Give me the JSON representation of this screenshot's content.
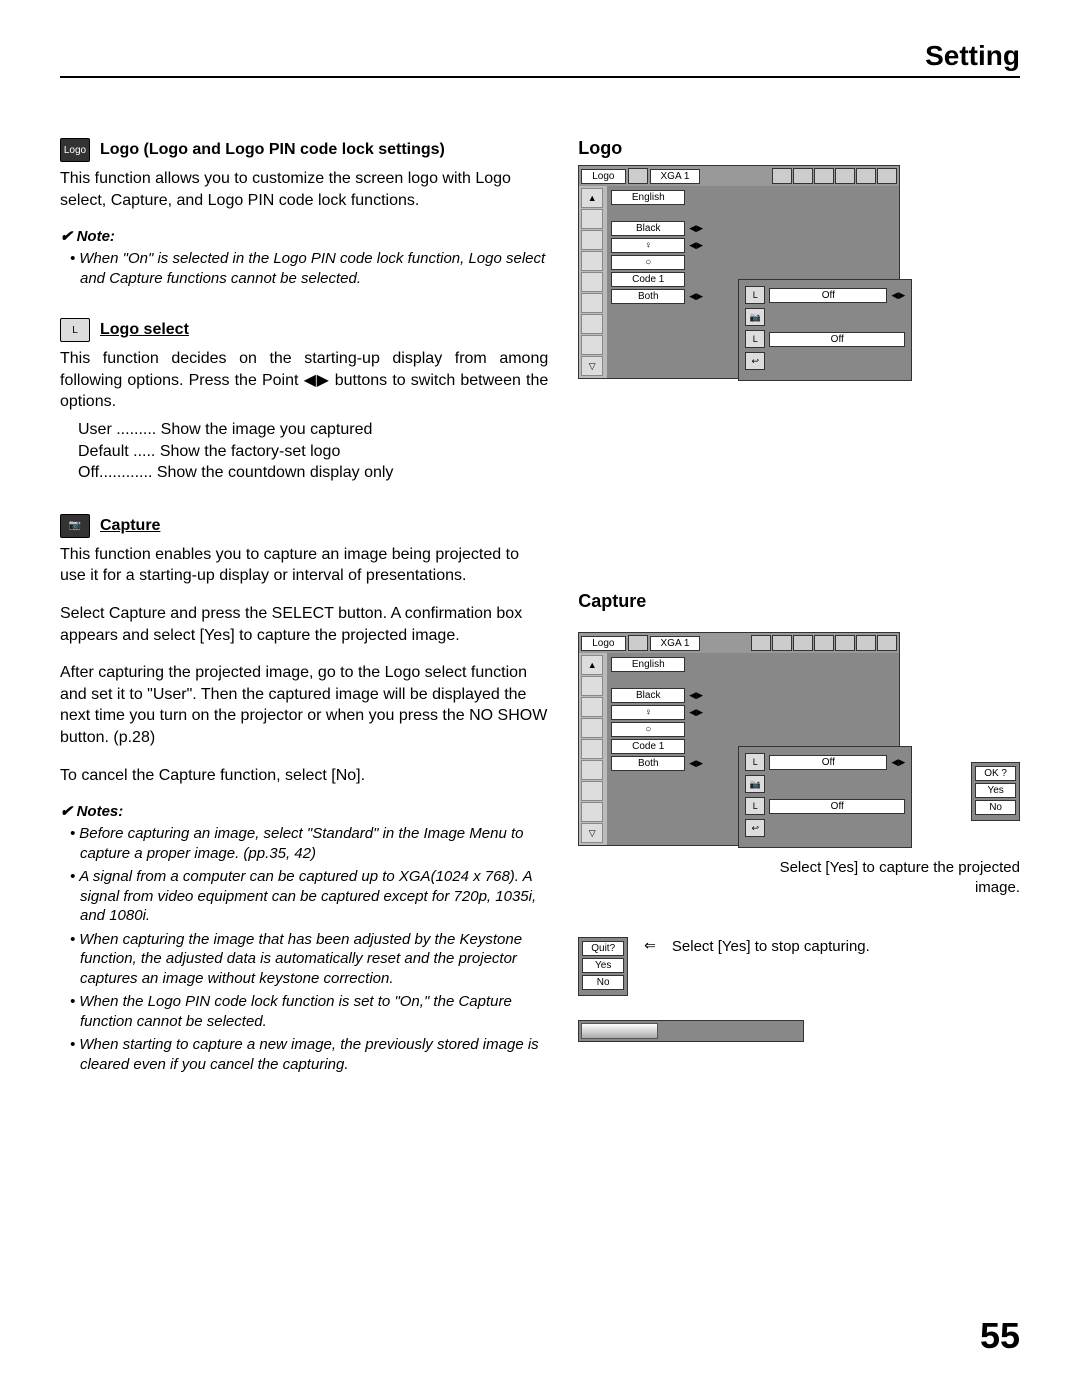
{
  "header": "Setting",
  "page_number": "55",
  "left": {
    "logo_section": {
      "title": "Logo (Logo and Logo PIN code lock settings)",
      "para1": "This function allows you to customize the screen logo with Logo select, Capture, and Logo PIN code lock functions.",
      "note_head": "Note:",
      "note1": "When \"On\" is selected in the Logo PIN code lock function, Logo select and Capture functions cannot be selected."
    },
    "logo_select": {
      "title": "Logo select",
      "para1": "This function decides on the starting-up display from among following options. Press the Point ◀▶ buttons to switch between the options.",
      "opt_user": "User ......... Show the image you captured",
      "opt_default": "Default ..... Show the factory-set logo",
      "opt_off": "Off............ Show the countdown display only"
    },
    "capture": {
      "title": "Capture",
      "para1": "This function enables you to capture an image being projected to use it for a starting-up display or interval of presentations.",
      "para2": "Select Capture and press the SELECT button. A confirmation box appears and select [Yes] to capture the projected image.",
      "para3": "After capturing the projected image, go to the Logo select function and set it to \"User\". Then the captured image will be displayed the next time you turn on the projector or when you press the NO SHOW button. (p.28)",
      "para4": "To cancel the Capture function, select [No].",
      "notes_head": "Notes:",
      "n1": "Before capturing an image, select \"Standard\" in the Image Menu to capture a proper image. (pp.35, 42)",
      "n2": "A signal from a computer can be captured up to XGA(1024 x 768).  A signal from video equipment can be captured except for 720p, 1035i, and 1080i.",
      "n3": "When capturing the image that has been adjusted by the Keystone function, the adjusted data is automatically reset and the projector captures an image without keystone correction.",
      "n4": "When the Logo PIN code lock function is set to \"On,\" the Capture function cannot be selected.",
      "n5": "When starting to capture a new image, the previously stored image is cleared even if you cancel the capturing."
    }
  },
  "right": {
    "logo_title": "Logo",
    "capture_title": "Capture",
    "menu": {
      "tab": "Logo",
      "mode": "XGA 1",
      "rows": [
        "English",
        "Black",
        "♀",
        "○",
        "Code 1",
        "Both"
      ],
      "sub_off1": "Off",
      "sub_off2": "Off"
    },
    "confirm": {
      "ok": "OK ?",
      "yes": "Yes",
      "no": "No"
    },
    "caption1": "Select [Yes] to capture the projected image.",
    "quit": {
      "quit": "Quit?",
      "yes": "Yes",
      "no": "No"
    },
    "caption2": "Select [Yes] to stop capturing."
  }
}
